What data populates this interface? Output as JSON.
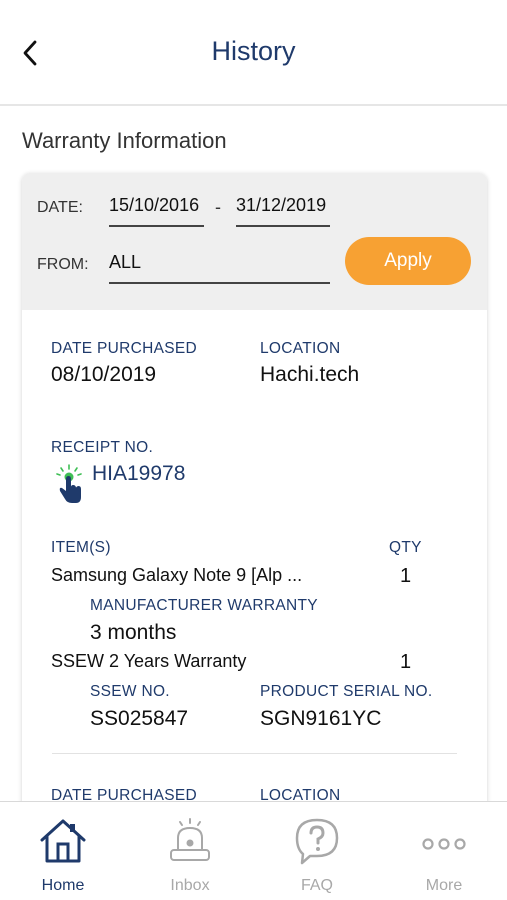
{
  "header": {
    "title": "History"
  },
  "section_title": "Warranty Information",
  "filter": {
    "date_label": "DATE:",
    "date_from": "15/10/2016",
    "date_separator": "-",
    "date_to": "31/12/2019",
    "from_label": "FROM:",
    "from_value": "ALL",
    "apply_label": "Apply"
  },
  "record": {
    "date_purchased_label": "DATE PURCHASED",
    "date_purchased": "08/10/2019",
    "location_label": "LOCATION",
    "location": "Hachi.tech",
    "receipt_label": "RECEIPT NO.",
    "receipt_no": "HIA19978",
    "items_label": "ITEM(S)",
    "qty_label": "QTY",
    "items": [
      {
        "name": "Samsung Galaxy Note 9 [Alp ...",
        "qty": "1"
      },
      {
        "name": "SSEW 2 Years Warranty",
        "qty": "1"
      }
    ],
    "manufacturer_warranty_label": "MANUFACTURER WARRANTY",
    "manufacturer_warranty": "3 months",
    "ssew_label": "SSEW NO.",
    "ssew_no": "SS025847",
    "serial_label": "PRODUCT SERIAL NO.",
    "serial_no": "SGN9161YC"
  },
  "next_record": {
    "date_purchased_label": "DATE PURCHASED",
    "location_label": "LOCATION"
  },
  "tabs": [
    {
      "label": "Home",
      "icon": "home-icon",
      "active": true
    },
    {
      "label": "Inbox",
      "icon": "bell-icon",
      "active": false
    },
    {
      "label": "FAQ",
      "icon": "question-icon",
      "active": false
    },
    {
      "label": "More",
      "icon": "more-icon",
      "active": false
    }
  ],
  "colors": {
    "primary": "#1f3a6b",
    "accent": "#f7a133",
    "inactive": "#a8a8a8",
    "filter_bg": "#efefef"
  }
}
